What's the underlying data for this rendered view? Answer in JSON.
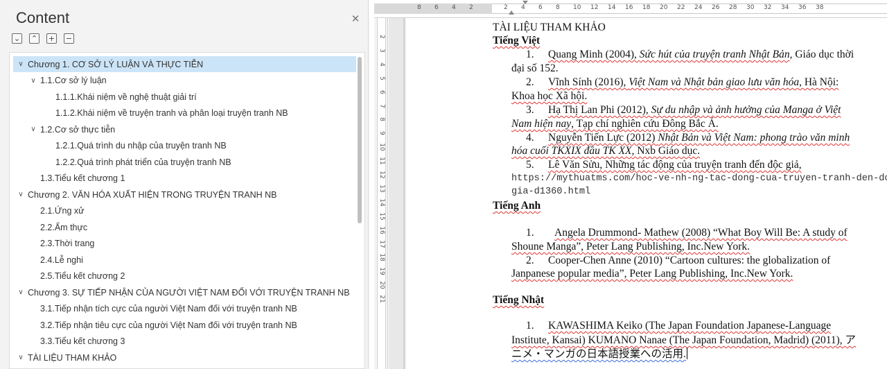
{
  "nav": {
    "title": "Content",
    "tools": [
      {
        "icon": "collapse-icon",
        "glyph": "⌄"
      },
      {
        "icon": "expand-icon",
        "glyph": "⌃"
      },
      {
        "icon": "expand-all-icon",
        "glyph": "+"
      },
      {
        "icon": "collapse-all-icon",
        "glyph": "−"
      }
    ],
    "close_glyph": "✕",
    "items": [
      {
        "label": "Chương 1. CƠ SỞ LÝ LUẬN VÀ THỰC TIỄN",
        "level": 0,
        "caret": "∨",
        "selected": true
      },
      {
        "label": "1.1.Cơ sở lý luận",
        "level": 1,
        "caret": "∨"
      },
      {
        "label": "1.1.1.Khái niệm về nghệ thuật giải trí",
        "level": 2,
        "caret": ""
      },
      {
        "label": "1.1.2.Khái niệm về truyện tranh và phân loại truyện tranh NB",
        "level": 2,
        "caret": ""
      },
      {
        "label": "1.2.Cơ sở thực tiễn",
        "level": 1,
        "caret": "∨"
      },
      {
        "label": "1.2.1.Quá trình du nhập của truyện tranh NB",
        "level": 2,
        "caret": ""
      },
      {
        "label": "1.2.2.Quá trình phát triển của truyện tranh NB",
        "level": 2,
        "caret": ""
      },
      {
        "label": "1.3.Tiểu kết chương 1",
        "level": 1,
        "caret": ""
      },
      {
        "label": "Chương 2. VĂN HÓA XUẤT HIỆN TRONG TRUYỆN TRANH NB",
        "level": 0,
        "caret": "∨"
      },
      {
        "label": "2.1.Ứng xử",
        "level": 1,
        "caret": ""
      },
      {
        "label": "2.2.Ẩm thực",
        "level": 1,
        "caret": ""
      },
      {
        "label": "2.3.Thời trang",
        "level": 1,
        "caret": ""
      },
      {
        "label": "2.4.Lễ nghi",
        "level": 1,
        "caret": ""
      },
      {
        "label": "2.5.Tiểu kết chương 2",
        "level": 1,
        "caret": ""
      },
      {
        "label": "Chương 3. SỰ TIẾP NHẬN CỦA NGƯỜI VIỆT NAM ĐỐI VỚI TRUYỆN TRANH NB",
        "level": 0,
        "caret": "∨"
      },
      {
        "label": "3.1.Tiếp nhận tích cực của người Việt Nam đối với truyện tranh NB",
        "level": 1,
        "caret": ""
      },
      {
        "label": "3.2.Tiếp nhận tiêu cực của người Việt Nam đối với truyện tranh NB",
        "level": 1,
        "caret": ""
      },
      {
        "label": "3.3.Tiểu kết chương 3",
        "level": 1,
        "caret": ""
      },
      {
        "label": "TÀI LIỆU THAM KHẢO",
        "level": 0,
        "caret": "∨"
      }
    ]
  },
  "ruler": {
    "top_numbers": [
      "8",
      "6",
      "4",
      "2",
      "2",
      "4",
      "6",
      "8",
      "10",
      "12",
      "14",
      "16",
      "18",
      "20",
      "22",
      "24",
      "26",
      "28",
      "30",
      "32",
      "34",
      "36",
      "38"
    ],
    "left_numbers": [
      "2",
      "3",
      "4",
      "5",
      "6",
      "7",
      "8",
      "9",
      "10",
      "11",
      "12",
      "13",
      "14",
      "15",
      "16",
      "17",
      "18",
      "19",
      "20",
      "21"
    ]
  },
  "doc": {
    "heading": "TÀI LIỆU THAM KHẢO",
    "sec_viet": "Tiếng Việt",
    "v1": {
      "num": "1.",
      "a": "Quang Minh (2004), ",
      "b": "Sức hút của truyện tranh Nhật Bản",
      "c": ", Giáo dục thời",
      "d": "đại số 152."
    },
    "v2": {
      "num": "2.",
      "a": "Vĩnh Sính (2016), ",
      "b": "Việt Nam và Nhật bản giao lưu văn hóa",
      "c": ", Hà Nội:",
      "d": "Khoa học Xã hội."
    },
    "v3": {
      "num": "3.",
      "a": "Hạ Thị Lan Phi (2012), ",
      "b": "Sự du nhập và ảnh hưởng của Manga ở Việt",
      "c": "Nam hiện nay",
      "d": ", Tạp chí nghiên cứu Đông Bắc Á."
    },
    "v4": {
      "num": "4.",
      "a": "Nguyễn Tiến Lực (2012) ",
      "b": "Nhật Bản và Việt Nam: phong trào văn minh",
      "c": "hóa cuối TKXIX đầu TK XX",
      "d": ", Nxb Giáo dục."
    },
    "v5": {
      "num": "5.",
      "a": "Lê Văn Sửu, Những tác động của truyện tranh đến độc giả,",
      "url1": "https://mythuatms.com/hoc-ve-nh-ng-tac-dong-cua-truyen-tranh-den-doc-",
      "url2": "gia-d1360.html"
    },
    "sec_anh": "Tiếng Anh",
    "e1": {
      "num": "1.",
      "a": "Angela Drummond- Mathew (2008)   “What Boy Will Be: A study of",
      "b": "Shoune Manga”, Peter Lang Publishing, Inc.New York."
    },
    "e2": {
      "num": "2.",
      "a": "Cooper-Chen Anne (2010) “Cartoon cultures: the globalization of",
      "b": "Janpanese popular media”, Peter Lang Publishing, Inc.New York."
    },
    "sec_nhat": "Tiếng Nhật",
    "j1": {
      "num": "1.",
      "a": "KAWASHIMA Keiko (The Japan Foundation Japanese-Language",
      "b": "Institute, Kansai) KUMANO Nanae (The Japan Foundation, Madrid) (2011), ア",
      "c": "ニメ・マンガの日本語授業への活用."
    }
  }
}
